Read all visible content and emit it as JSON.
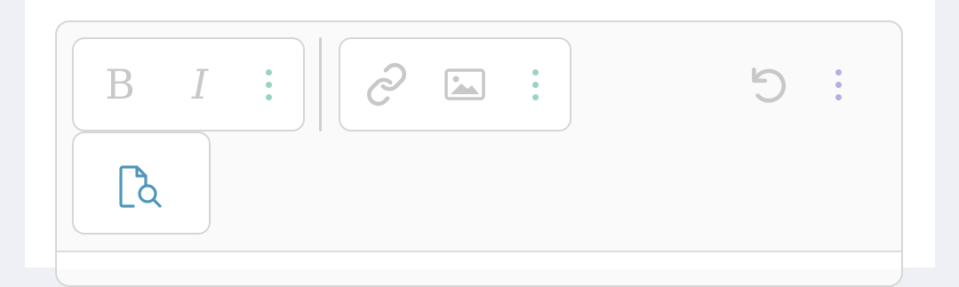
{
  "toolbar": {
    "format_group": {
      "bold_label": "B",
      "italic_label": "I",
      "more_icon": "vertical-ellipsis-icon"
    },
    "insert_group": {
      "link_icon": "link-icon",
      "image_icon": "image-icon",
      "more_icon": "vertical-ellipsis-icon"
    },
    "undo_icon": "undo-icon",
    "more_icon": "vertical-ellipsis-icon",
    "preview_icon": "file-search-icon"
  },
  "colors": {
    "disabled_icon": "#c8c8c8",
    "more_dots_group": "#9cd3bf",
    "more_dots_toolbar": "#b7addf",
    "preview_icon": "#4f96b8",
    "border": "#d6d6d6"
  }
}
